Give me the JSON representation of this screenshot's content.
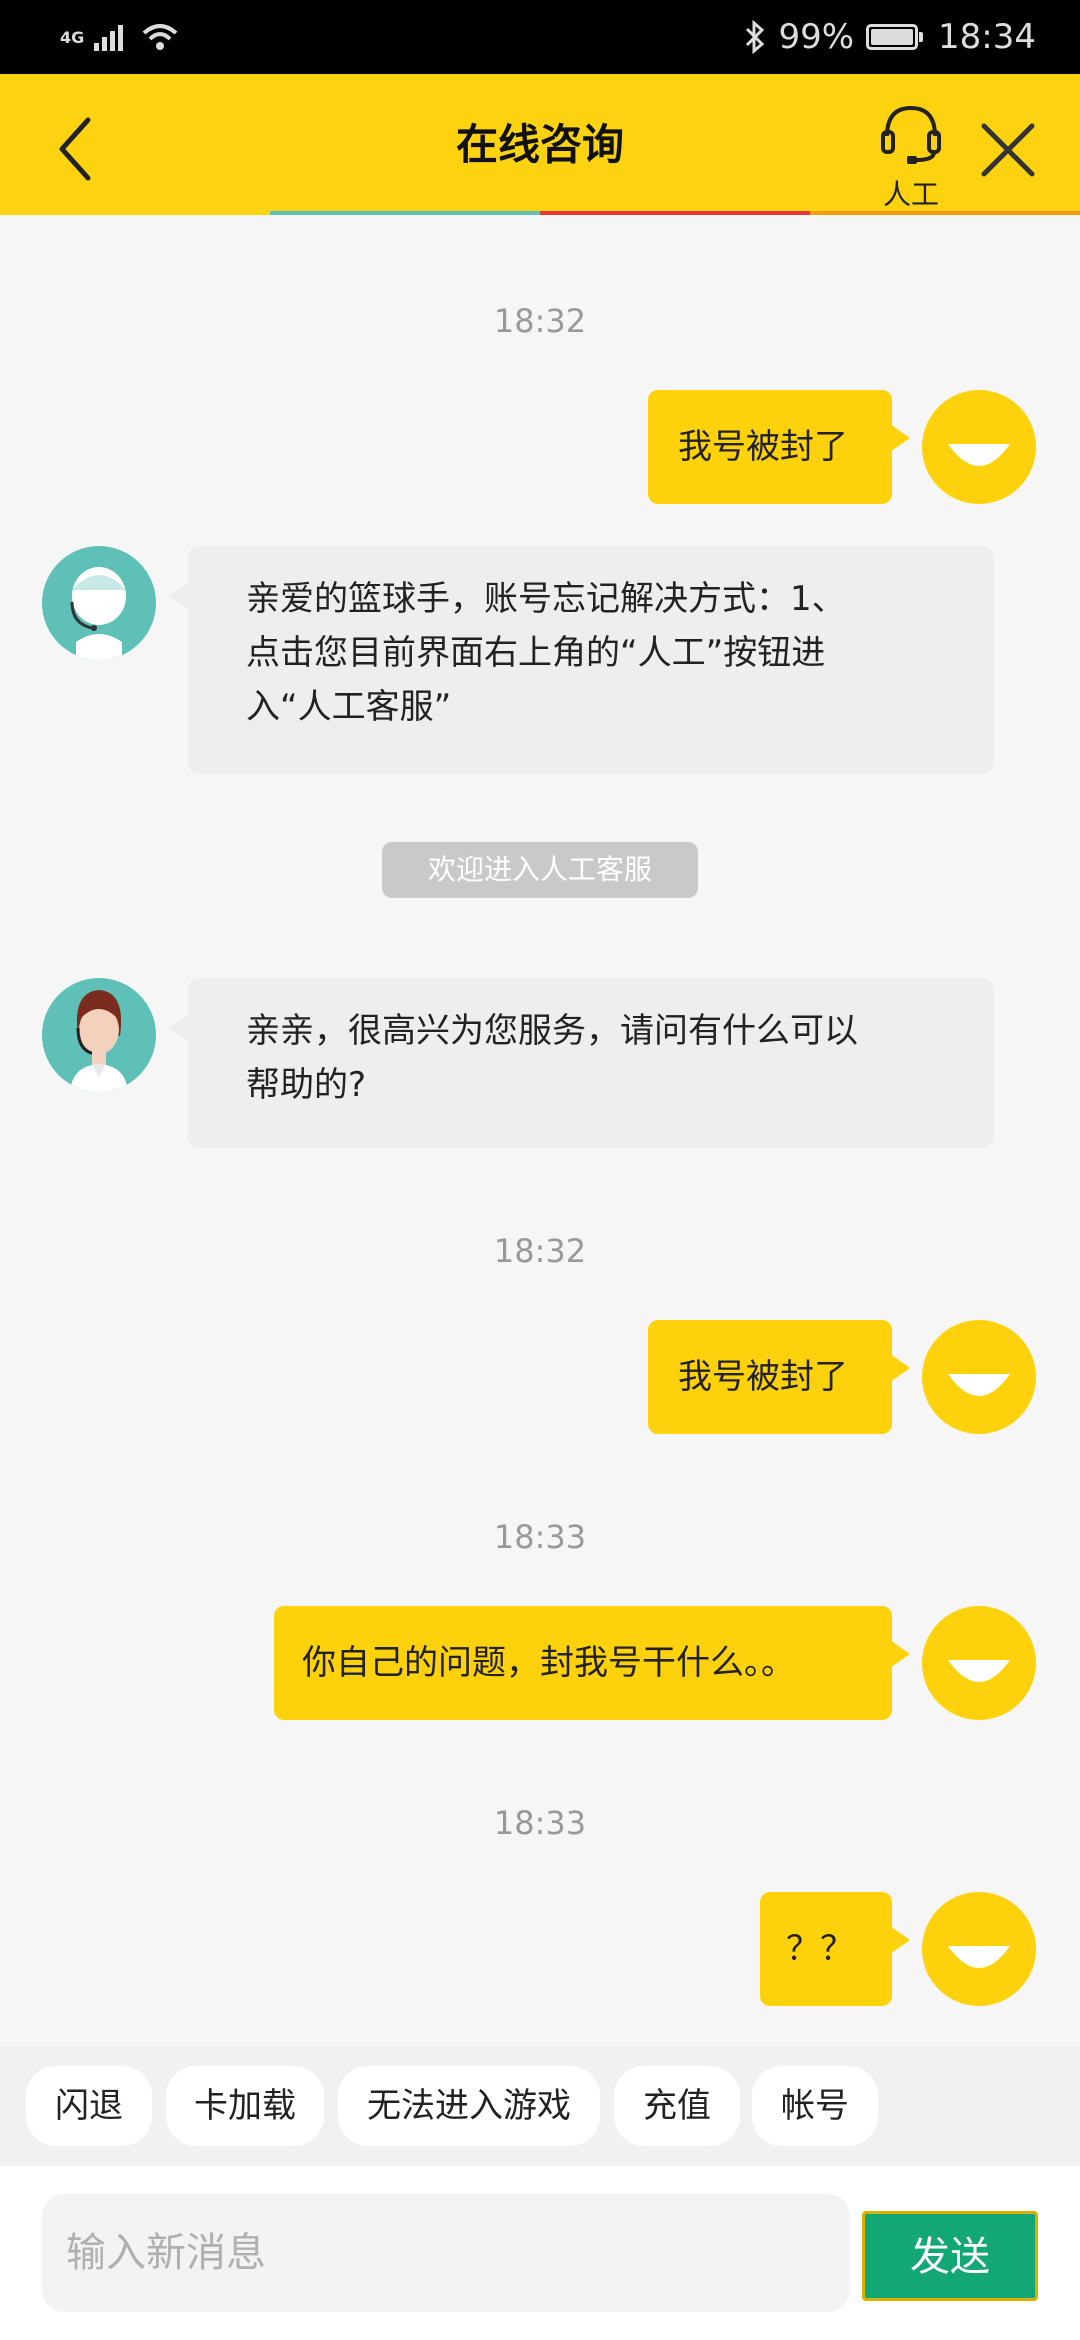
{
  "status_bar": {
    "network": "4G",
    "battery": "99%",
    "time": "18:34"
  },
  "header": {
    "title": "在线咨询",
    "human_label": "人工",
    "accent": "#fcd211"
  },
  "messages": {
    "time1": "18:32",
    "user1": "我号被封了",
    "agent1_lines": [
      "亲爱的篮球手，账号忘记解决方式：1、",
      "点击您目前界面右上角的“人工”按钮进",
      "入“人工客服”"
    ],
    "notice": "欢迎进入人工客服",
    "agent2_lines": [
      "亲亲，很高兴为您服务，请问有什么可以",
      "帮助的?"
    ],
    "time2": "18:32",
    "user2": "我号被封了",
    "time3": "18:33",
    "user3": "你自己的问题，封我号干什么。。",
    "time4": "18:33",
    "user4": "？？"
  },
  "quick_replies": [
    "闪退",
    "卡加载",
    "无法进入游戏",
    "充值",
    "帐号"
  ],
  "input": {
    "placeholder": "输入新消息",
    "value": ""
  },
  "send_label": "发送",
  "colors": {
    "bubble_user": "#fdd20d",
    "send_button": "#12a774",
    "agent_avatar_bg": "#5ec0b7"
  }
}
